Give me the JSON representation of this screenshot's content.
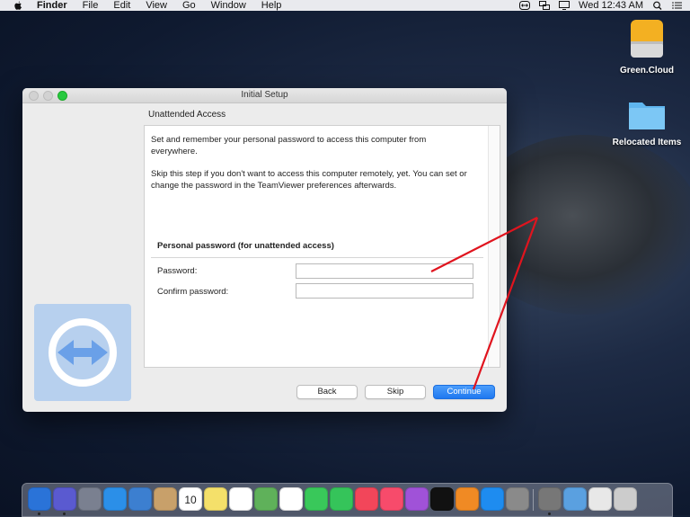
{
  "menubar": {
    "app": "Finder",
    "menus": [
      "File",
      "Edit",
      "View",
      "Go",
      "Window",
      "Help"
    ],
    "clock": "Wed 12:43 AM"
  },
  "desktop": {
    "icons": [
      {
        "label": "Green.Cloud",
        "icon": "external-drive-icon"
      },
      {
        "label": "Relocated Items",
        "icon": "folder-icon"
      }
    ]
  },
  "window": {
    "title": "Initial Setup",
    "section_title": "Unattended Access",
    "intro_line1": "Set and remember your personal password to access this computer from everywhere.",
    "intro_line2": "Skip this step if you don't want to access this computer remotely, yet. You can set or change the password in the TeamViewer preferences afterwards.",
    "password_section_title": "Personal password (for unattended access)",
    "password_label": "Password:",
    "confirm_label": "Confirm password:",
    "password_value": "",
    "confirm_value": "",
    "buttons": {
      "back": "Back",
      "skip": "Skip",
      "continue": "Continue"
    }
  },
  "dock": {
    "icons": [
      "finder-icon",
      "siri-icon",
      "launchpad-icon",
      "safari-icon",
      "photo-preview-icon",
      "contacts-icon",
      "calendar-icon",
      "notes-icon",
      "reminders-icon",
      "maps-icon",
      "photos-icon",
      "messages-icon",
      "facetime-icon",
      "news-icon",
      "music-icon",
      "podcasts-icon",
      "tv-icon",
      "books-icon",
      "app-store-icon",
      "system-preferences-icon",
      "utility-icon",
      "screenshots-icon",
      "downloads-icon",
      "trash-icon"
    ],
    "calendar_day": "10",
    "colors": [
      "#2a73d8",
      "#5a5ad0",
      "#7a8090",
      "#2b8fe8",
      "#3c7fd0",
      "#c8a06a",
      "#ffffff",
      "#f4e06a",
      "#ffffff",
      "#5fb15a",
      "#ffffff",
      "#39c85a",
      "#35c45a",
      "#f2465a",
      "#f74b6b",
      "#a052d8",
      "#111111",
      "#f08a24",
      "#1e8cf0",
      "#8a8a8a",
      "#777777",
      "#5aa0e0",
      "#e8e8e8",
      "#cccccc"
    ]
  },
  "annotation_color": "#e0141e"
}
